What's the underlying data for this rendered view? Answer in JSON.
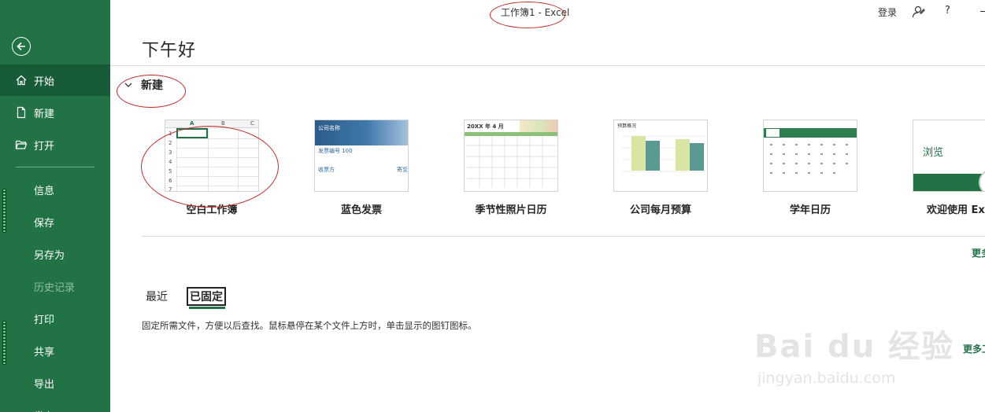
{
  "titlebar": {
    "title": "工作簿1  -  Excel",
    "sign_in": "登录",
    "help": "?"
  },
  "sidebar": {
    "items": [
      {
        "label": "开始"
      },
      {
        "label": "新建"
      },
      {
        "label": "打开"
      },
      {
        "label": "信息"
      },
      {
        "label": "保存"
      },
      {
        "label": "另存为"
      },
      {
        "label": "历史记录"
      },
      {
        "label": "打印"
      },
      {
        "label": "共享"
      },
      {
        "label": "导出"
      },
      {
        "label": "发布"
      }
    ]
  },
  "main": {
    "greeting": "下午好",
    "new_section_title": "新建",
    "templates": [
      {
        "label": "空白工作簿"
      },
      {
        "label": "蓝色发票"
      },
      {
        "label": "季节性照片日历"
      },
      {
        "label": "公司每月预算"
      },
      {
        "label": "学年日历"
      },
      {
        "label": "欢迎使用 Excel"
      }
    ],
    "blank_grid": {
      "columns": [
        "A",
        "B",
        "C"
      ],
      "rows": [
        "1",
        "2",
        "3",
        "4",
        "5",
        "6",
        "7"
      ]
    },
    "invoice_thumb": {
      "company": "公司名称",
      "invoice_no": "发票编号 100",
      "bill_to": "收票方",
      "ship_to": "寄至"
    },
    "calendar_thumb": {
      "title": "20XX 年 4 月"
    },
    "budget_thumb": {
      "title": "预算概况"
    },
    "welcome_thumb": {
      "text": "浏览"
    },
    "more_templates": "更多模板",
    "tabs": {
      "recent": "最近",
      "pinned": "已固定"
    },
    "pinned_description": "固定所需文件，方便以后查找。鼠标悬停在某个文件上方时，单击显示的图钉图标。",
    "more_workbooks": "更多工作簿"
  },
  "watermark": {
    "brand": "Bai du 经验",
    "url": "jingyan.baidu.com"
  },
  "colors": {
    "sidebar": "#217346",
    "sidebar_active": "#185c37",
    "accent": "#217346",
    "annotation": "#c62828"
  }
}
